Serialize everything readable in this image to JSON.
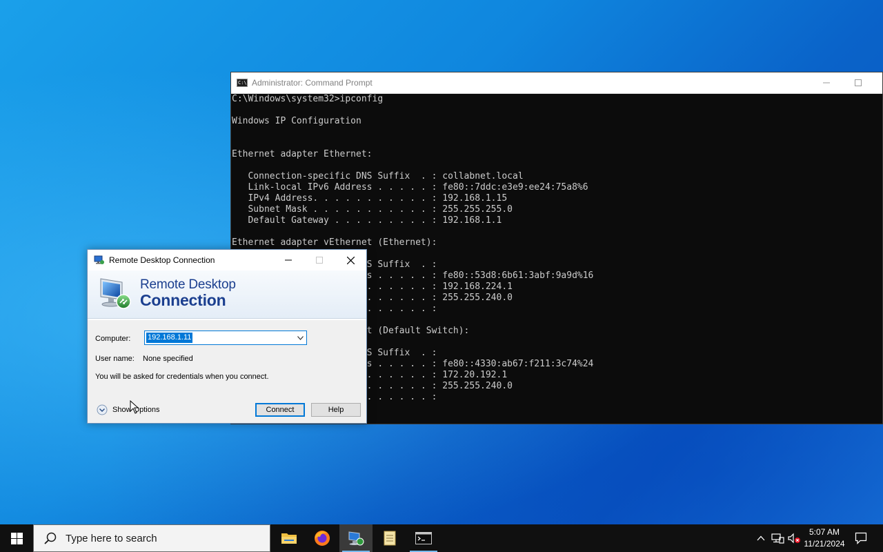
{
  "desktop": {},
  "cmd": {
    "title": "Administrator: Command Prompt",
    "lines": [
      "C:\\Windows\\system32>ipconfig",
      "",
      "Windows IP Configuration",
      "",
      "",
      "Ethernet adapter Ethernet:",
      "",
      "   Connection-specific DNS Suffix  . : collabnet.local",
      "   Link-local IPv6 Address . . . . . : fe80::7ddc:e3e9:ee24:75a8%6",
      "   IPv4 Address. . . . . . . . . . . : 192.168.1.15",
      "   Subnet Mask . . . . . . . . . . . : 255.255.255.0",
      "   Default Gateway . . . . . . . . . : 192.168.1.1",
      "",
      "Ethernet adapter vEthernet (Ethernet):",
      "",
      "   Connection-specific DNS Suffix  . :",
      "   Link-local IPv6 Address . . . . . : fe80::53d8:6b61:3abf:9a9d%16",
      "   IPv4 Address. . . . . . . . . . . : 192.168.224.1",
      "   Subnet Mask . . . . . . . . . . . : 255.255.240.0",
      "   Default Gateway . . . . . . . . . :",
      "",
      "Ethernet adapter vEthernet (Default Switch):",
      "",
      "   Connection-specific DNS Suffix  . :",
      "   Link-local IPv6 Address . . . . . : fe80::4330:ab67:f211:3c74%24",
      "   IPv4 Address. . . . . . . . . . . : 172.20.192.1",
      "   Subnet Mask . . . . . . . . . . . : 255.255.240.0",
      "   Default Gateway . . . . . . . . . :"
    ]
  },
  "rdc": {
    "title": "Remote Desktop Connection",
    "heading_line1": "Remote Desktop",
    "heading_line2": "Connection",
    "computer_label": "Computer:",
    "computer_value": "192.168.1.11",
    "username_label": "User name:",
    "username_value": "None specified",
    "info_text": "You will be asked for credentials when you connect.",
    "show_options_label": "Show Options",
    "connect_label": "Connect",
    "help_label": "Help"
  },
  "taskbar": {
    "search_placeholder": "Type here to search",
    "pinned_apps": [
      "File Explorer",
      "Firefox",
      "Remote Desktop Connection",
      "Notepad",
      "Command Prompt"
    ],
    "active_app": "Remote Desktop Connection",
    "clock_time": "5:07 AM",
    "clock_date": "11/21/2024"
  }
}
